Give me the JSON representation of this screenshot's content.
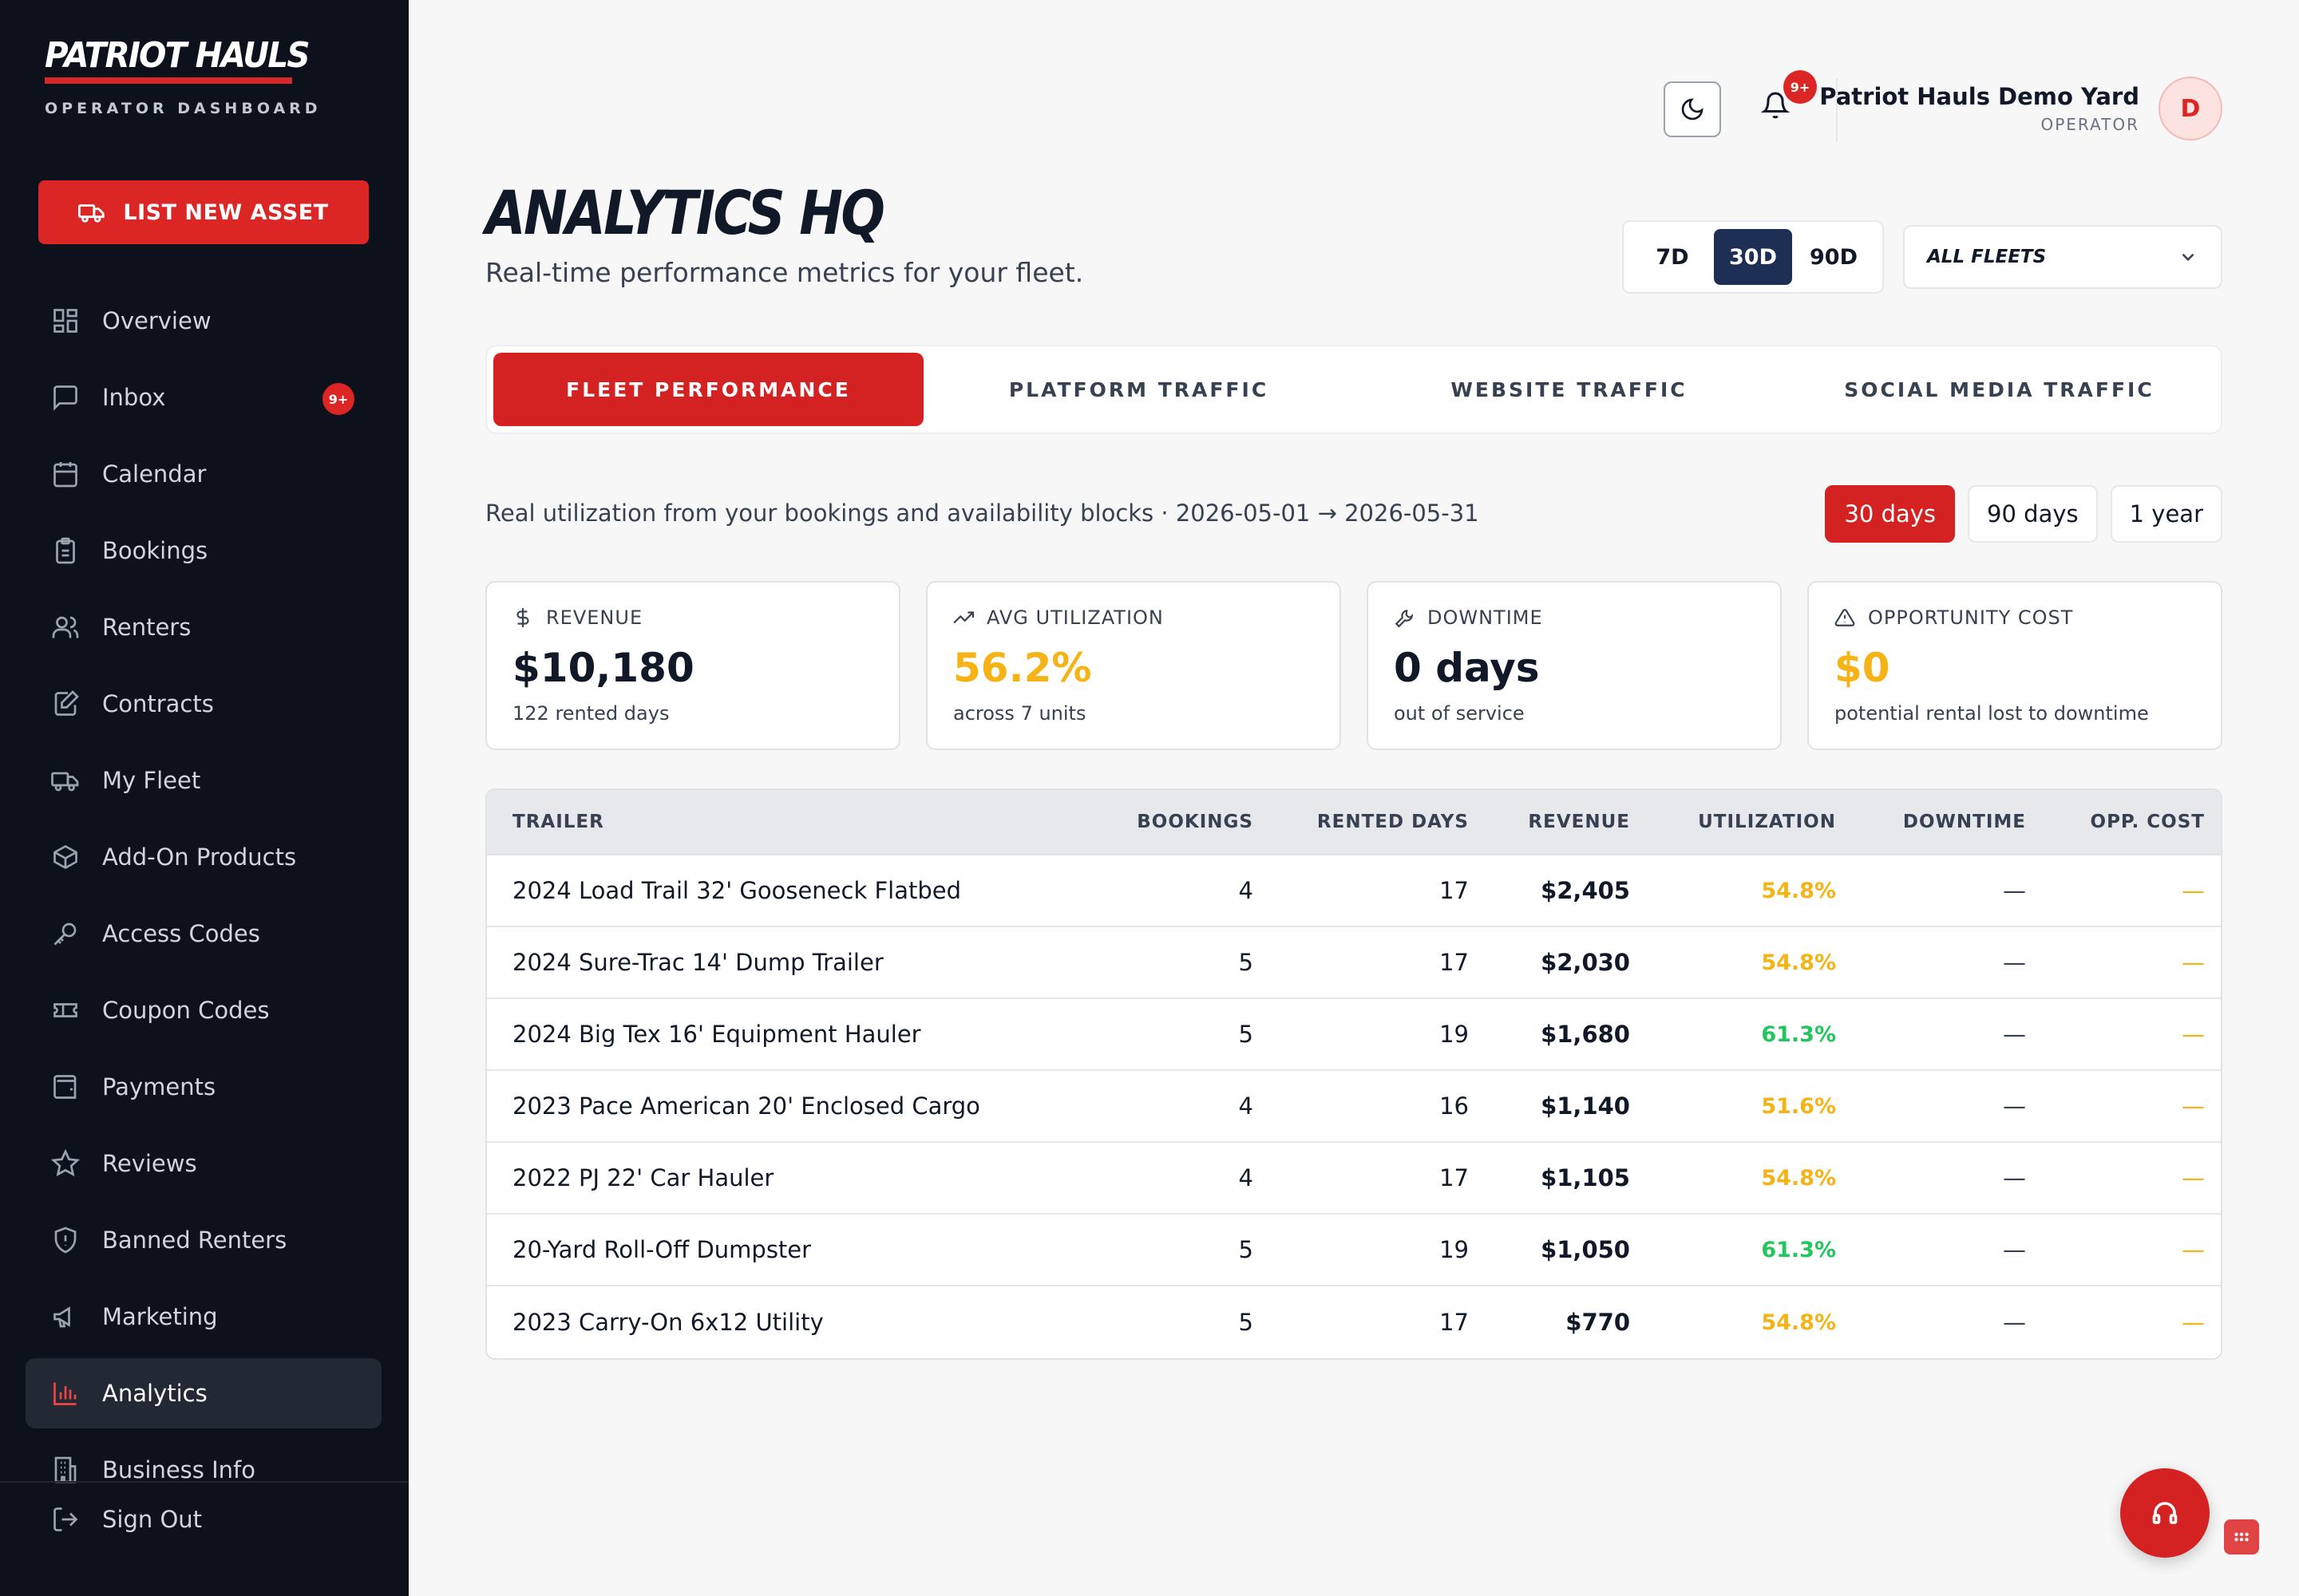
{
  "brand": {
    "name": "PATRIOT HAULS",
    "subtitle": "OPERATOR DASHBOARD",
    "accent": "#dc2626",
    "sidebar_bg": "#0c111b"
  },
  "sidebar": {
    "cta_label": "LIST NEW ASSET",
    "items": [
      {
        "label": "Overview",
        "icon": "grid-icon"
      },
      {
        "label": "Inbox",
        "icon": "chat-icon",
        "badge": "9+"
      },
      {
        "label": "Calendar",
        "icon": "calendar-icon"
      },
      {
        "label": "Bookings",
        "icon": "clipboard-icon"
      },
      {
        "label": "Renters",
        "icon": "users-icon"
      },
      {
        "label": "Contracts",
        "icon": "document-edit-icon"
      },
      {
        "label": "My Fleet",
        "icon": "truck-icon"
      },
      {
        "label": "Add-On Products",
        "icon": "box-icon"
      },
      {
        "label": "Access Codes",
        "icon": "key-icon"
      },
      {
        "label": "Coupon Codes",
        "icon": "ticket-icon"
      },
      {
        "label": "Payments",
        "icon": "wallet-icon"
      },
      {
        "label": "Reviews",
        "icon": "star-icon"
      },
      {
        "label": "Banned Renters",
        "icon": "shield-icon"
      },
      {
        "label": "Marketing",
        "icon": "megaphone-icon"
      },
      {
        "label": "Analytics",
        "icon": "bar-chart-icon",
        "active": true
      },
      {
        "label": "Business Info",
        "icon": "building-icon"
      }
    ],
    "signout_label": "Sign Out"
  },
  "header": {
    "notification_badge": "9+",
    "user_name": "Patriot Hauls Demo Yard",
    "user_role": "OPERATOR",
    "avatar_initial": "D"
  },
  "page": {
    "title": "ANALYTICS HQ",
    "subtitle": "Real-time performance metrics for your fleet.",
    "range_options": [
      "7D",
      "30D",
      "90D"
    ],
    "range_selected": "30D",
    "fleet_select": "ALL FLEETS"
  },
  "tabs": [
    {
      "label": "FLEET PERFORMANCE",
      "active": true
    },
    {
      "label": "PLATFORM TRAFFIC"
    },
    {
      "label": "WEBSITE TRAFFIC"
    },
    {
      "label": "SOCIAL MEDIA TRAFFIC"
    }
  ],
  "info_line": "Real utilization from your bookings and availability blocks · 2026-05-01 → 2026-05-31",
  "periods": [
    {
      "label": "30 days",
      "active": true
    },
    {
      "label": "90 days"
    },
    {
      "label": "1 year"
    }
  ],
  "stats": [
    {
      "label": "REVENUE",
      "icon": "dollar-icon",
      "value": "$10,180",
      "sub": "122 rented days",
      "highlight": false
    },
    {
      "label": "AVG UTILIZATION",
      "icon": "trending-up-icon",
      "value": "56.2%",
      "sub": "across 7 units",
      "highlight": true
    },
    {
      "label": "DOWNTIME",
      "icon": "wrench-icon",
      "value": "0 days",
      "sub": "out of service",
      "highlight": false
    },
    {
      "label": "OPPORTUNITY COST",
      "icon": "warning-icon",
      "value": "$0",
      "sub": "potential rental lost to downtime",
      "highlight": true
    }
  ],
  "table": {
    "columns": [
      "TRAILER",
      "BOOKINGS",
      "RENTED DAYS",
      "REVENUE",
      "UTILIZATION",
      "DOWNTIME",
      "OPP. COST"
    ],
    "rows": [
      {
        "trailer": "2024 Load Trail 32' Gooseneck Flatbed",
        "bookings": "4",
        "rented_days": "17",
        "revenue": "$2,405",
        "utilization": "54.8%",
        "util_status": "amber",
        "downtime": "—",
        "opp_cost": "—"
      },
      {
        "trailer": "2024 Sure-Trac 14' Dump Trailer",
        "bookings": "5",
        "rented_days": "17",
        "revenue": "$2,030",
        "utilization": "54.8%",
        "util_status": "amber",
        "downtime": "—",
        "opp_cost": "—"
      },
      {
        "trailer": "2024 Big Tex 16' Equipment Hauler",
        "bookings": "5",
        "rented_days": "19",
        "revenue": "$1,680",
        "utilization": "61.3%",
        "util_status": "green",
        "downtime": "—",
        "opp_cost": "—"
      },
      {
        "trailer": "2023 Pace American 20' Enclosed Cargo",
        "bookings": "4",
        "rented_days": "16",
        "revenue": "$1,140",
        "utilization": "51.6%",
        "util_status": "amber",
        "downtime": "—",
        "opp_cost": "—"
      },
      {
        "trailer": "2022 PJ 22' Car Hauler",
        "bookings": "4",
        "rented_days": "17",
        "revenue": "$1,105",
        "utilization": "54.8%",
        "util_status": "amber",
        "downtime": "—",
        "opp_cost": "—"
      },
      {
        "trailer": "20-Yard Roll-Off Dumpster",
        "bookings": "5",
        "rented_days": "19",
        "revenue": "$1,050",
        "utilization": "61.3%",
        "util_status": "green",
        "downtime": "—",
        "opp_cost": "—"
      },
      {
        "trailer": "2023 Carry-On 6x12 Utility",
        "bookings": "5",
        "rented_days": "17",
        "revenue": "$770",
        "utilization": "54.8%",
        "util_status": "amber",
        "downtime": "—",
        "opp_cost": "—"
      }
    ]
  },
  "status_colors": {
    "amber": "#f5b316",
    "green": "#22c55e"
  }
}
